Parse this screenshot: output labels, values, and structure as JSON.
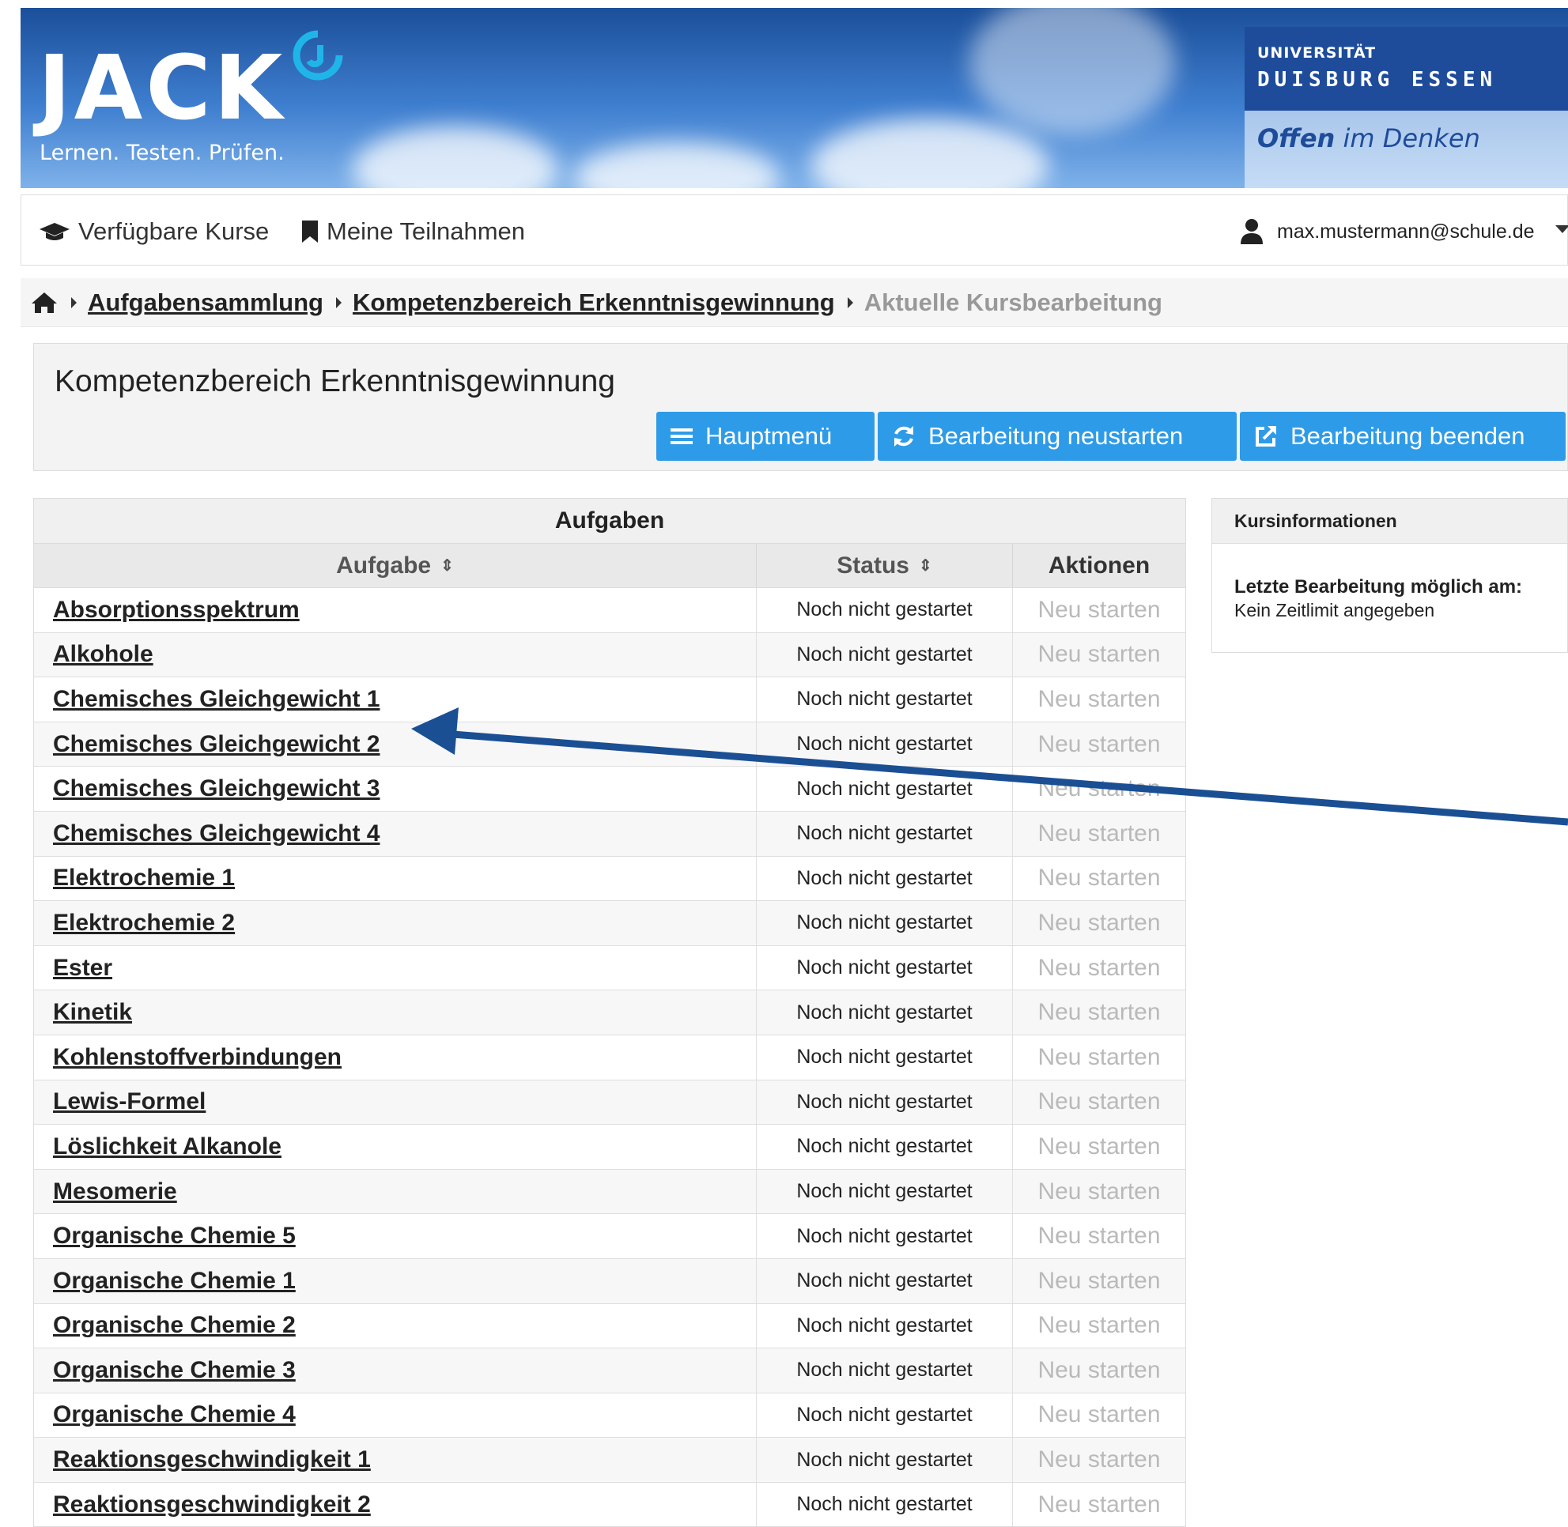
{
  "header": {
    "logo_text": "JACK",
    "tagline": "Lernen. Testen. Prüfen.",
    "university_top": "UNIVERSITÄT",
    "university_name": "DUISBURG ESSEN",
    "university_slogan_bold": "Offen",
    "university_slogan_rest": " im Denken"
  },
  "navbar": {
    "available_courses": "Verfügbare Kurse",
    "my_participations": "Meine Teilnahmen",
    "user_email": "max.mustermann@schule.de"
  },
  "breadcrumb": {
    "items": [
      "Aufgabensammlung",
      "Kompetenzbereich Erkenntnisgewinnung"
    ],
    "current": "Aktuelle Kursbearbeitung"
  },
  "title_panel": {
    "title": "Kompetenzbereich Erkenntnisgewinnung",
    "buttons": {
      "main_menu": "Hauptmenü",
      "restart": "Bearbeitung neustarten",
      "end": "Bearbeitung beenden"
    }
  },
  "tasks_table": {
    "caption": "Aufgaben",
    "columns": {
      "task": "Aufgabe",
      "status": "Status",
      "actions": "Aktionen"
    },
    "rows": [
      {
        "name": "Absorptionsspektrum",
        "status": "Noch nicht gestartet",
        "action": "Neu starten"
      },
      {
        "name": "Alkohole",
        "status": "Noch nicht gestartet",
        "action": "Neu starten"
      },
      {
        "name": "Chemisches Gleichgewicht 1",
        "status": "Noch nicht gestartet",
        "action": "Neu starten"
      },
      {
        "name": "Chemisches Gleichgewicht 2",
        "status": "Noch nicht gestartet",
        "action": "Neu starten"
      },
      {
        "name": "Chemisches Gleichgewicht 3",
        "status": "Noch nicht gestartet",
        "action": "Neu starten"
      },
      {
        "name": "Chemisches Gleichgewicht 4",
        "status": "Noch nicht gestartet",
        "action": "Neu starten"
      },
      {
        "name": "Elektrochemie 1",
        "status": "Noch nicht gestartet",
        "action": "Neu starten"
      },
      {
        "name": "Elektrochemie 2",
        "status": "Noch nicht gestartet",
        "action": "Neu starten"
      },
      {
        "name": "Ester",
        "status": "Noch nicht gestartet",
        "action": "Neu starten"
      },
      {
        "name": "Kinetik",
        "status": "Noch nicht gestartet",
        "action": "Neu starten"
      },
      {
        "name": "Kohlenstoffverbindungen",
        "status": "Noch nicht gestartet",
        "action": "Neu starten"
      },
      {
        "name": "Lewis-Formel",
        "status": "Noch nicht gestartet",
        "action": "Neu starten"
      },
      {
        "name": "Löslichkeit Alkanole",
        "status": "Noch nicht gestartet",
        "action": "Neu starten"
      },
      {
        "name": "Mesomerie",
        "status": "Noch nicht gestartet",
        "action": "Neu starten"
      },
      {
        "name": "Organische Chemie 5",
        "status": "Noch nicht gestartet",
        "action": "Neu starten"
      },
      {
        "name": "Organische Chemie 1",
        "status": "Noch nicht gestartet",
        "action": "Neu starten"
      },
      {
        "name": "Organische Chemie 2",
        "status": "Noch nicht gestartet",
        "action": "Neu starten"
      },
      {
        "name": "Organische Chemie 3",
        "status": "Noch nicht gestartet",
        "action": "Neu starten"
      },
      {
        "name": "Organische Chemie 4",
        "status": "Noch nicht gestartet",
        "action": "Neu starten"
      },
      {
        "name": "Reaktionsgeschwindigkeit 1",
        "status": "Noch nicht gestartet",
        "action": "Neu starten"
      },
      {
        "name": "Reaktionsgeschwindigkeit 2",
        "status": "Noch nicht gestartet",
        "action": "Neu starten"
      }
    ]
  },
  "course_info": {
    "title": "Kursinformationen",
    "label": "Letzte Bearbeitung möglich am:",
    "value": "Kein Zeitlimit angegeben"
  },
  "icons": {
    "home": "home-icon",
    "graduation": "graduation-cap-icon",
    "bookmark": "bookmark-icon",
    "user": "user-icon",
    "menu": "bars-icon",
    "refresh": "refresh-icon",
    "external": "external-link-icon",
    "sort": "sort-icon"
  },
  "colors": {
    "primary_button": "#2e9be8",
    "banner_blue": "#1b4f9a",
    "university_blue": "#1e4c9a",
    "annotation_arrow": "#1b4f94"
  }
}
